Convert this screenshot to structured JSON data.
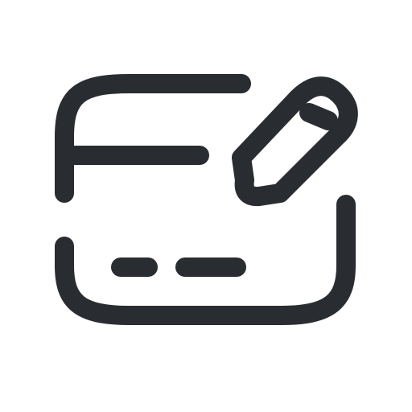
{
  "icon": {
    "name": "card-edit-icon",
    "stroke_color": "#292d32",
    "background": "#ffffff"
  }
}
